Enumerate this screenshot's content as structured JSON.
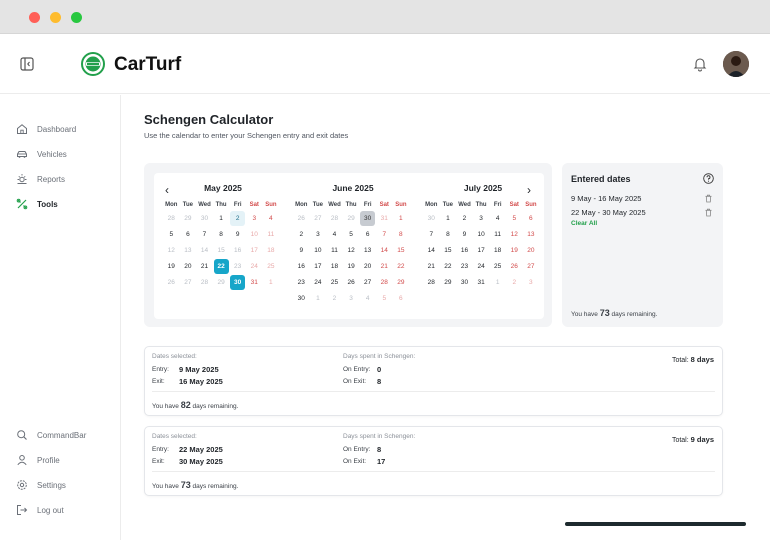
{
  "app": {
    "brand": "CarTurf"
  },
  "sidebar": {
    "primary": [
      {
        "label": "Dashboard",
        "icon": "home-icon"
      },
      {
        "label": "Vehicles",
        "icon": "car-icon"
      },
      {
        "label": "Reports",
        "icon": "reports-icon"
      },
      {
        "label": "Tools",
        "icon": "tools-icon",
        "active": true
      }
    ],
    "secondary": [
      {
        "label": "CommandBar",
        "icon": "search-icon"
      },
      {
        "label": "Profile",
        "icon": "user-icon"
      },
      {
        "label": "Settings",
        "icon": "gear-icon"
      },
      {
        "label": "Log out",
        "icon": "logout-icon"
      }
    ]
  },
  "page": {
    "title": "Schengen Calculator",
    "subtitle": "Use the calendar to enter your Schengen entry and exit dates"
  },
  "calendar": {
    "weekdays": [
      "Mon",
      "Tue",
      "Wed",
      "Thu",
      "Fri",
      "Sat",
      "Sun"
    ],
    "months": [
      {
        "title": "May  2025",
        "weeks": [
          [
            "28",
            "29",
            "30",
            "1",
            "2",
            "3",
            "4"
          ],
          [
            "5",
            "6",
            "7",
            "8",
            "9",
            "10",
            "11"
          ],
          [
            "12",
            "13",
            "14",
            "15",
            "16",
            "17",
            "18"
          ],
          [
            "19",
            "20",
            "21",
            "22",
            "23",
            "24",
            "25"
          ],
          [
            "26",
            "27",
            "28",
            "29",
            "30",
            "31",
            "1"
          ]
        ]
      },
      {
        "title": "June  2025",
        "weeks": [
          [
            "26",
            "27",
            "28",
            "29",
            "30",
            "31",
            "1"
          ],
          [
            "2",
            "3",
            "4",
            "5",
            "6",
            "7",
            "8"
          ],
          [
            "9",
            "10",
            "11",
            "12",
            "13",
            "14",
            "15"
          ],
          [
            "16",
            "17",
            "18",
            "19",
            "20",
            "21",
            "22"
          ],
          [
            "23",
            "24",
            "25",
            "26",
            "27",
            "28",
            "29"
          ],
          [
            "30",
            "1",
            "2",
            "3",
            "4",
            "5",
            "6"
          ]
        ]
      },
      {
        "title": "July  2025",
        "weeks": [
          [
            "30",
            "1",
            "2",
            "3",
            "4",
            "5",
            "6"
          ],
          [
            "7",
            "8",
            "9",
            "10",
            "11",
            "12",
            "13"
          ],
          [
            "14",
            "15",
            "16",
            "17",
            "18",
            "19",
            "20"
          ],
          [
            "21",
            "22",
            "23",
            "24",
            "25",
            "26",
            "27"
          ],
          [
            "28",
            "29",
            "30",
            "31",
            "1",
            "2",
            "3"
          ]
        ]
      }
    ]
  },
  "entered": {
    "title": "Entered dates",
    "ranges": [
      "9 May - 16 May 2025",
      "22 May - 30 May 2025"
    ],
    "clear_label": "Clear All",
    "remaining_prefix": "You have",
    "remaining_days": "73",
    "remaining_suffix": "days remaining."
  },
  "results": [
    {
      "dates_label": "Dates selected:",
      "entry_key": "Entry:",
      "entry_val": "9 May 2025",
      "exit_key": "Exit:",
      "exit_val": "16 May 2025",
      "days_label": "Days spent in Schengen:",
      "on_entry_key": "On Entry:",
      "on_entry_val": "0",
      "on_exit_key": "On Exit:",
      "on_exit_val": "8",
      "total_prefix": "Total:",
      "total_val": "8 days",
      "remaining_prefix": "You have",
      "remaining_days": "82",
      "remaining_suffix": "days remaining."
    },
    {
      "dates_label": "Dates selected:",
      "entry_key": "Entry:",
      "entry_val": "22 May 2025",
      "exit_key": "Exit:",
      "exit_val": "30 May 2025",
      "days_label": "Days spent in Schengen:",
      "on_entry_key": "On Entry:",
      "on_entry_val": "8",
      "on_exit_key": "On Exit:",
      "on_exit_val": "17",
      "total_prefix": "Total:",
      "total_val": "9 days",
      "remaining_prefix": "You have",
      "remaining_days": "73",
      "remaining_suffix": "days remaining."
    }
  ],
  "colors": {
    "accent": "#17a6c9",
    "brand_green": "#22a04b",
    "weekend_red": "#d24a4a"
  }
}
